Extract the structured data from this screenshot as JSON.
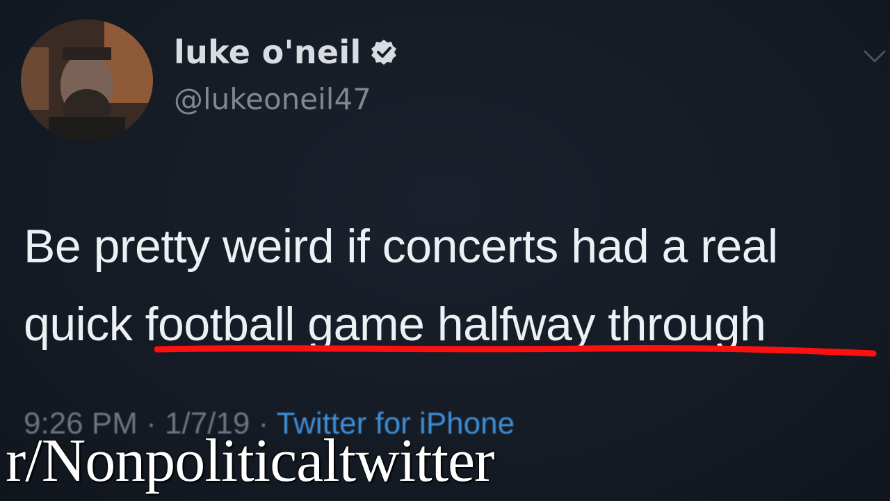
{
  "tweet": {
    "display_name": "luke o'neil",
    "verified": true,
    "handle": "@lukeoneil47",
    "text_line_1": "Be pretty weird if concerts had a real",
    "text_line_2_start": "quick ",
    "text_line_2_underlined": "football game halfway through",
    "time": "9:26 PM",
    "separator": "·",
    "date": "1/7/19",
    "source": "Twitter for iPhone"
  },
  "overlay": {
    "watermark": "r/Nonpoliticaltwitter"
  },
  "icons": {
    "verified": "verified-badge-icon",
    "menu": "chevron-down-icon"
  },
  "colors": {
    "background": "#151b25",
    "underline": "#ff1010",
    "source_link": "#3f8fd8"
  }
}
